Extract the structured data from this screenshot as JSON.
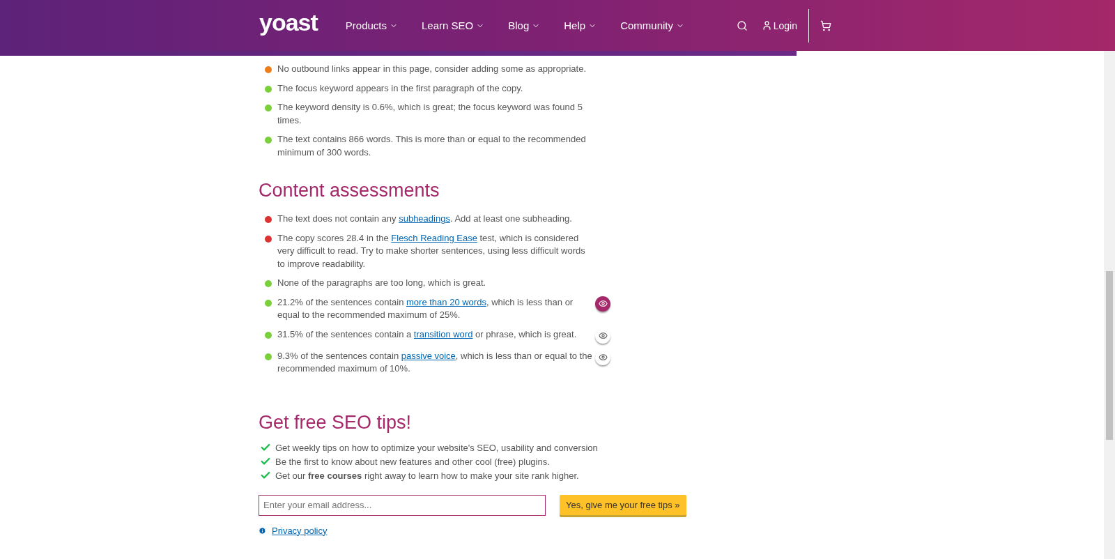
{
  "header": {
    "logo": "yoast",
    "nav": [
      {
        "label": "Products"
      },
      {
        "label": "Learn SEO"
      },
      {
        "label": "Blog"
      },
      {
        "label": "Help"
      },
      {
        "label": "Community"
      }
    ],
    "login": "Login"
  },
  "seo_assessments": [
    {
      "color": "#ee7c1b",
      "text": "No outbound links appear in this page, consider adding some as appropriate."
    },
    {
      "color": "#7ad03a",
      "text": "The focus keyword appears in the first paragraph of the copy."
    },
    {
      "color": "#7ad03a",
      "text": "The keyword density is 0.6%, which is great; the focus keyword was found 5 times."
    },
    {
      "color": "#7ad03a",
      "text": "The text contains 866 words. This is more than or equal to the recommended minimum of 300 words."
    }
  ],
  "content_heading": "Content assessments",
  "content_assessments": [
    {
      "color": "#dc3232",
      "text_before": "The text does not contain any ",
      "link": "subheadings",
      "text_after": ". Add at least one subheading."
    },
    {
      "color": "#dc3232",
      "text_before": "The copy scores 28.4 in the ",
      "link": "Flesch Reading Ease",
      "text_after": " test, which is considered very difficult to read. Try to make shorter sentences, using less difficult words to improve readability."
    },
    {
      "color": "#7ad03a",
      "text_before": "None of the paragraphs are too long, which is great."
    },
    {
      "color": "#7ad03a",
      "text_before": "21.2% of the sentences contain ",
      "link": "more than 20 words",
      "text_after": ", which is less than or equal to the recommended maximum of 25%.",
      "eye": {
        "selected": true
      }
    },
    {
      "color": "#7ad03a",
      "text_before": "31.5% of the sentences contain a ",
      "link": "transition word",
      "text_after": " or phrase, which is great.",
      "eye": {
        "selected": false
      }
    },
    {
      "color": "#7ad03a",
      "text_before": "9.3% of the sentences contain ",
      "link": "passive voice",
      "text_after": ", which is less than or equal to the recommended maximum of 10%.",
      "eye": {
        "selected": false
      }
    }
  ],
  "tips": {
    "heading": "Get free SEO tips!",
    "items": [
      "Get weekly tips on how to optimize your website's SEO, usability and conversion",
      "Be the first to know about new features and other cool (free) plugins.",
      "Get our **free courses** right away to learn how to make your site rank higher."
    ],
    "email": {
      "placeholder": "Enter your email address..."
    },
    "submit": "Yes, give me your free tips »",
    "privacy": "Privacy policy"
  }
}
